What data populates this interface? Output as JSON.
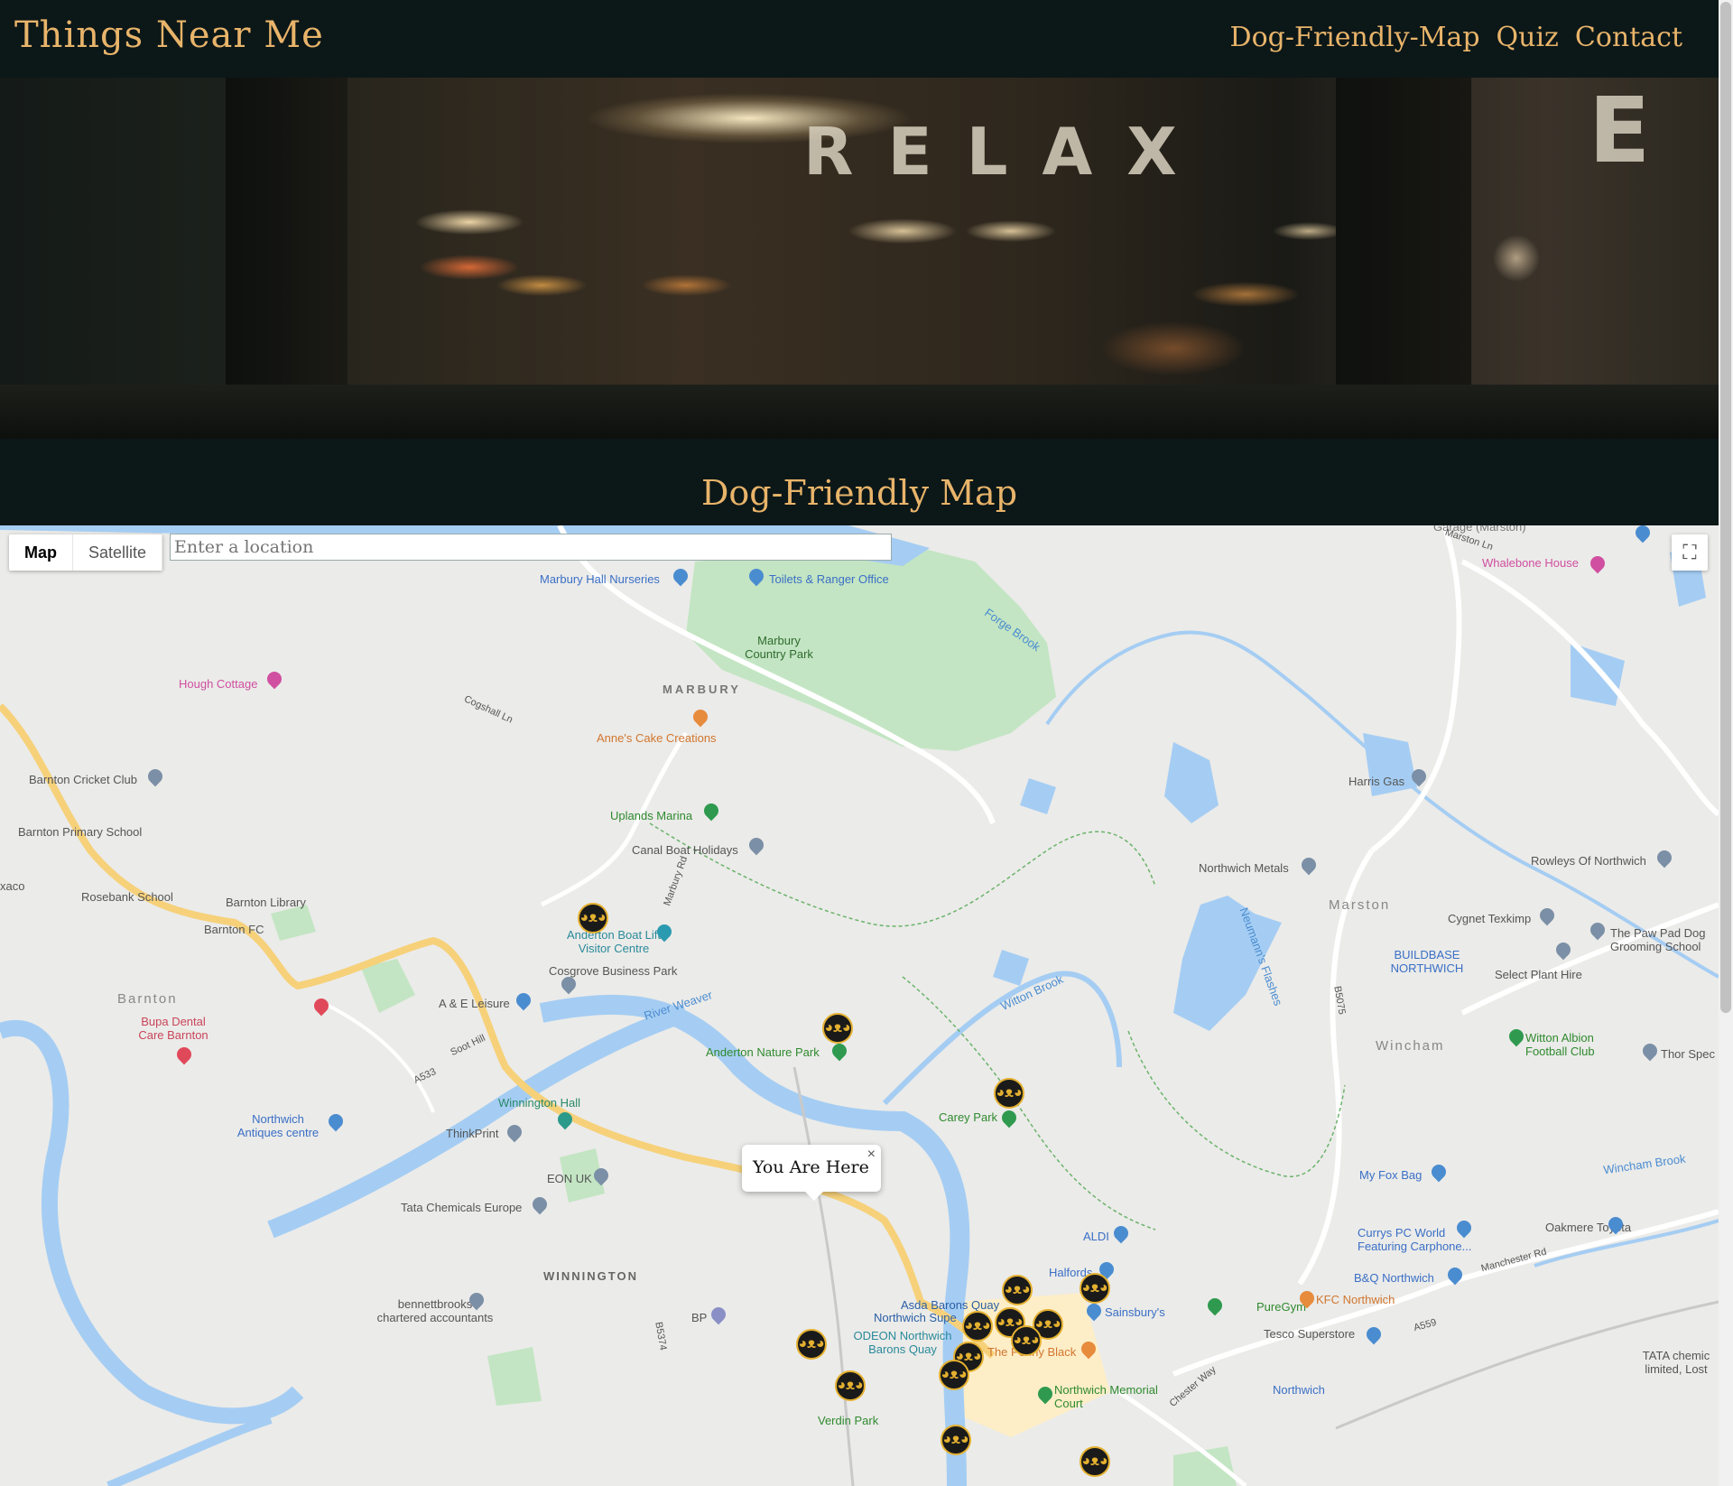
{
  "site": {
    "title": "Things Near Me"
  },
  "nav": {
    "items": [
      "Dog-Friendly-Map",
      "Quiz",
      "Contact"
    ]
  },
  "hero": {
    "sign_text": "RELAX",
    "sign_text_right": "E"
  },
  "section": {
    "title": "Dog-Friendly Map"
  },
  "map": {
    "type_control": {
      "map_label": "Map",
      "satellite_label": "Satellite",
      "selected": "Map"
    },
    "search": {
      "placeholder": "Enter a location",
      "value": ""
    },
    "fullscreen_icon": "fullscreen-icon",
    "info_window": {
      "text": "You Are Here",
      "close": "×"
    },
    "marker_icon": "dog-face-icon",
    "colors": {
      "land": "#ebebe9",
      "water": "#a5cdf3",
      "park": "#c3e5c3",
      "major_road": "#fde293",
      "road": "#ffffff",
      "town_center": "#fdeec8",
      "marker_ring": "#e4b030"
    },
    "place_labels": [
      "Marbury Hall Nurseries",
      "Toilets & Ranger Office",
      "Marbury Country Park",
      "MARBURY",
      "Anne's Cake Creations",
      "Hough Cottage",
      "Barnton Cricket Club",
      "Barnton Primary School",
      "Rosebank School",
      "Barnton Library",
      "Barnton FC",
      "Uplands Marina",
      "Canal Boat Holidays",
      "Anderton Boat Lift Visitor Centre",
      "Cosgrove Business Park",
      "A & E Leisure",
      "Barnton",
      "Bupa Dental Care Barnton",
      "Northwich Antiques centre",
      "Winnington Hall",
      "ThinkPrint",
      "EON UK",
      "Tata Chemicals Europe",
      "WINNINGTON",
      "bennettbrooks chartered accountants",
      "BP",
      "Anderton Nature Park",
      "Carey Park",
      "Verdin Park",
      "Harris Gas",
      "Northwich Metals",
      "Rowleys Of Northwich",
      "Marston",
      "Cygnet Texkimp",
      "BUILDBASE NORTHWICH",
      "The Paw Pad Dog Grooming School",
      "Select Plant Hire",
      "Wincham",
      "Witton Albion Football Club",
      "Thor Spec",
      "Neumann's Flashes",
      "Whalebone House",
      "Garage (Marston)",
      "My Fox Bag",
      "ALDI",
      "Halfords",
      "Asda Barons Quay",
      "Northwich Supe",
      "ODEON Northwich Barons Quay",
      "Sainsbury's",
      "PureGym",
      "KFC Northwich",
      "Currys PC World Featuring Carphone...",
      "B&Q Northwich",
      "Oakmere Toyota",
      "Tesco Superstore",
      "Northwich",
      "Northwich Memorial Court",
      "The Penny Black",
      "TATA chemic limited, Lost",
      "River Weaver",
      "Witton Brook",
      "Forge Brook",
      "Wincham Brook",
      "xaco"
    ],
    "road_labels": [
      "A533",
      "B5075",
      "B5374",
      "A559",
      "Marston Ln",
      "Soot Hill",
      "Chester Way",
      "Manchester Rd",
      "Marbury Rd",
      "Cogshall Ln"
    ]
  }
}
